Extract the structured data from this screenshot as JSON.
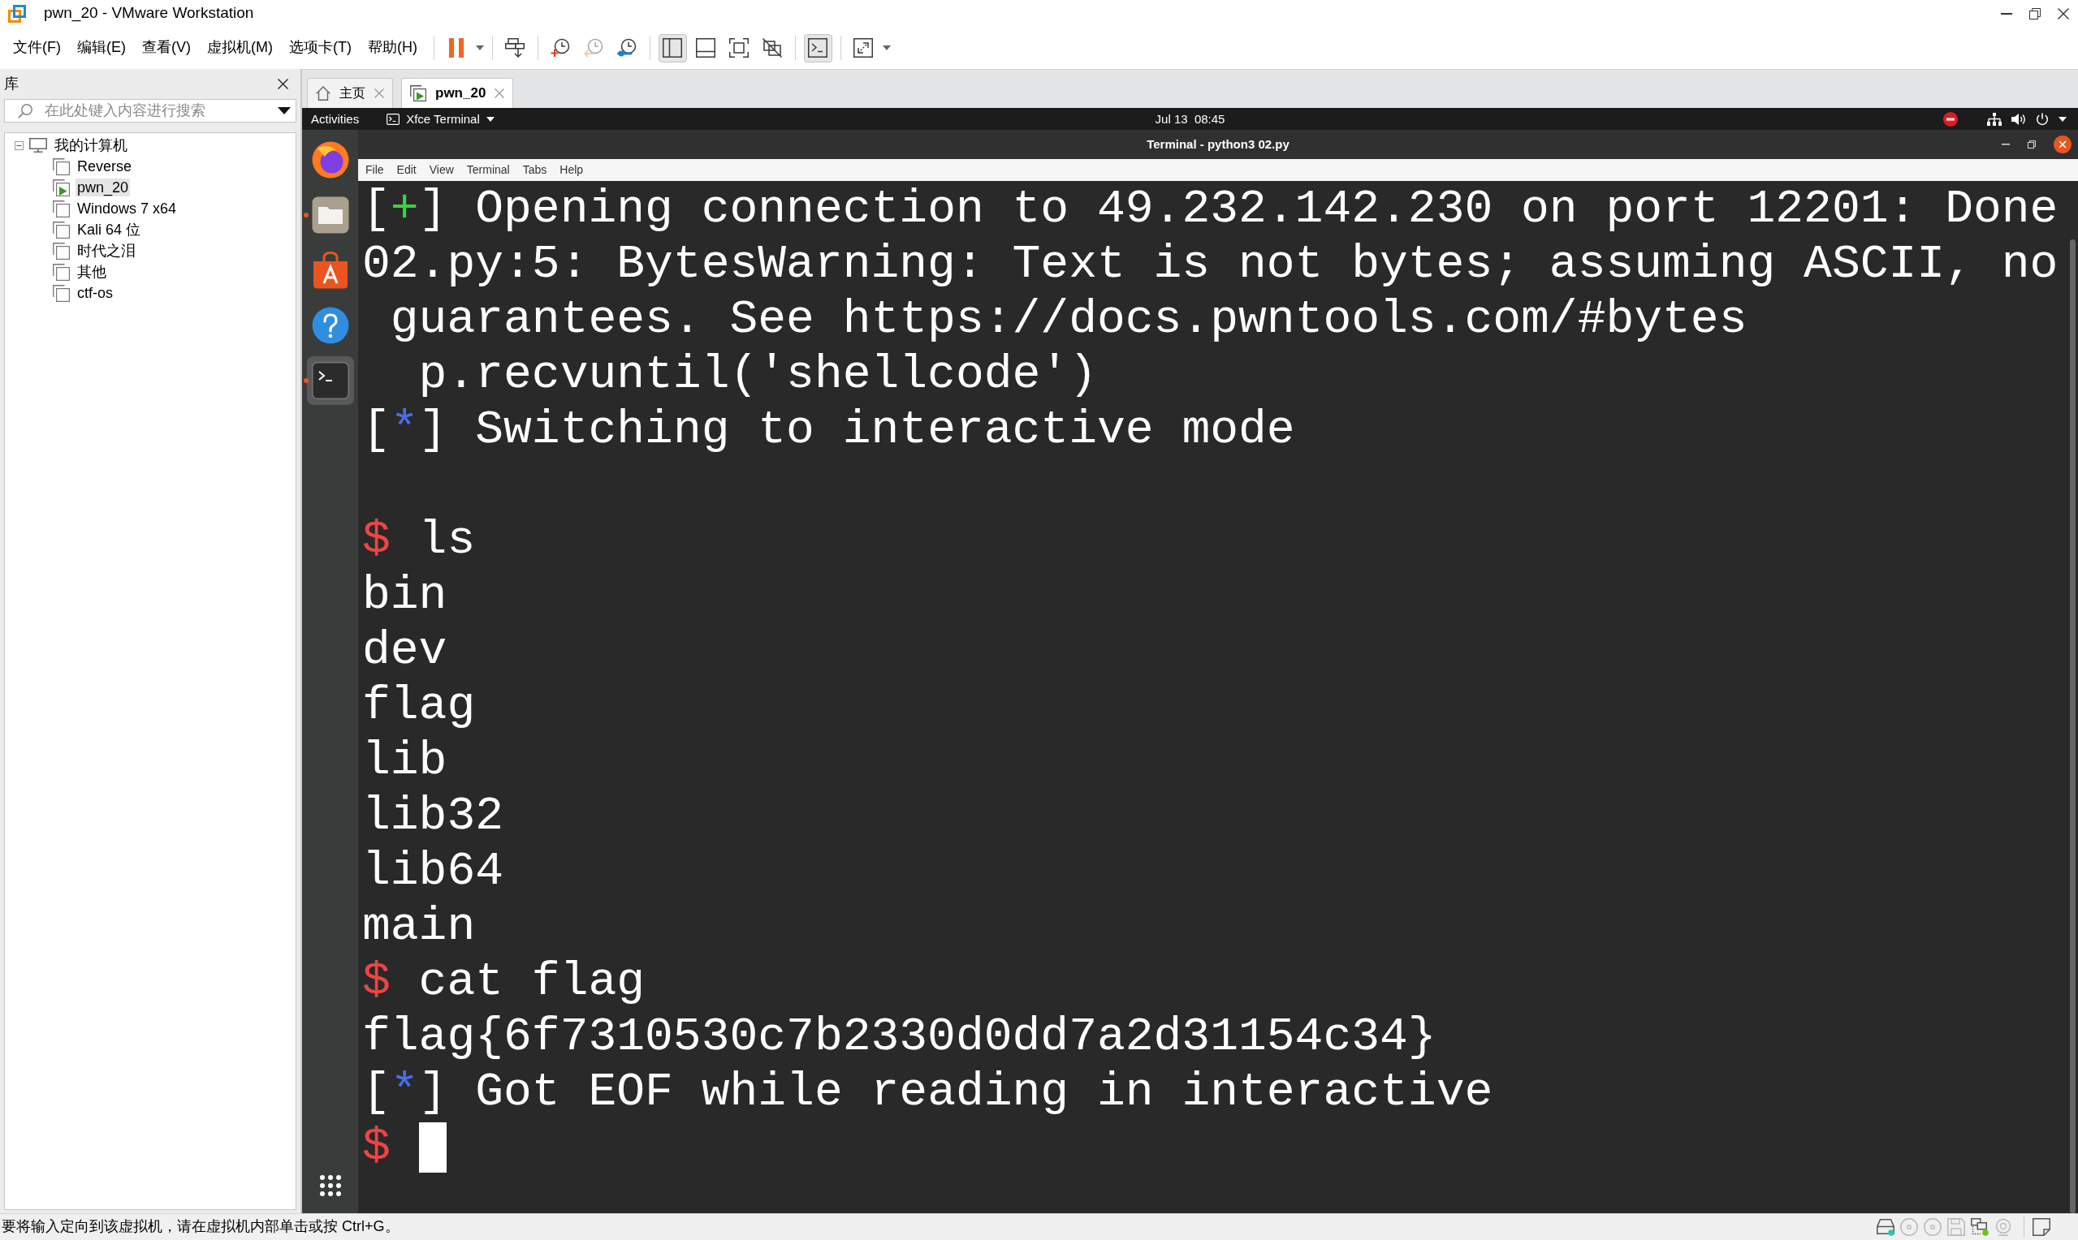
{
  "window": {
    "title": "pwn_20 - VMware Workstation"
  },
  "menu": [
    "文件(F)",
    "编辑(E)",
    "查看(V)",
    "虚拟机(M)",
    "选项卡(T)",
    "帮助(H)"
  ],
  "toolbar": [
    [
      {
        "kind": "pause",
        "menu": true
      }
    ],
    [
      {
        "kind": "send-keys"
      }
    ],
    [
      {
        "kind": "snapshot-take",
        "disabled": false
      },
      {
        "kind": "snapshot-revert",
        "disabled": true
      },
      {
        "kind": "snapshot-manager",
        "disabled": false
      }
    ],
    [
      {
        "kind": "library-view",
        "selected": true
      },
      {
        "kind": "thumbnail-bar",
        "selected": false
      },
      {
        "kind": "full-screen",
        "selected": false
      },
      {
        "kind": "unity",
        "selected": false
      }
    ],
    [
      {
        "kind": "console-view",
        "selected": true
      }
    ],
    [
      {
        "kind": "stretch",
        "menu": true
      }
    ]
  ],
  "library": {
    "title": "库",
    "search": {
      "placeholder": "在此处键入内容进行搜索"
    },
    "tree": [
      {
        "label": "我的计算机",
        "expanded": true,
        "children": [
          {
            "label": "Reverse",
            "selected": false,
            "running": false
          },
          {
            "label": "pwn_20",
            "selected": true,
            "running": true
          },
          {
            "label": "Windows 7 x64",
            "selected": false,
            "running": false
          },
          {
            "label": "Kali 64 位",
            "selected": false,
            "running": false
          },
          {
            "label": "时代之泪",
            "selected": false,
            "running": false
          },
          {
            "label": "其他",
            "selected": false,
            "running": false
          },
          {
            "label": "ctf-os",
            "selected": false,
            "running": false
          }
        ]
      }
    ]
  },
  "tabs": [
    {
      "kind": "home",
      "label": "主页",
      "selected": false
    },
    {
      "kind": "vm",
      "label": "pwn_20",
      "selected": true
    }
  ],
  "guest": {
    "top_bar": {
      "activities": "Activities",
      "app_menu": "Xfce Terminal",
      "clock": "Jul 13  08:45"
    },
    "dock": [
      {
        "kind": "browser",
        "running": false,
        "selected": false
      },
      {
        "kind": "files",
        "running": true,
        "selected": false
      },
      {
        "kind": "software",
        "running": false,
        "selected": false
      },
      {
        "kind": "help",
        "running": false,
        "selected": false
      },
      {
        "kind": "terminal",
        "running": true,
        "selected": true
      }
    ],
    "terminal": {
      "title": "Terminal - python3 02.py",
      "menu": [
        "File",
        "Edit",
        "View",
        "Terminal",
        "Tabs",
        "Help"
      ],
      "lines": [
        {
          "kind": "success",
          "segments": [
            "[",
            "+",
            "] Opening connection to 49.232.142.230 on port 12201: Done"
          ]
        },
        {
          "kind": "output",
          "text": "02.py:5: BytesWarning: Text is not bytes; assuming ASCII, no"
        },
        {
          "kind": "output",
          "text": " guarantees. See https://docs.pwntools.com/#bytes"
        },
        {
          "kind": "output",
          "text": "  p.recvuntil('shellcode')"
        },
        {
          "kind": "info",
          "segments": [
            "[",
            "*",
            "] Switching to interactive mode"
          ]
        },
        {
          "kind": "blank"
        },
        {
          "kind": "prompt",
          "segments": [
            "$",
            " ls"
          ],
          "cursor": false
        },
        {
          "kind": "output",
          "text": "bin"
        },
        {
          "kind": "output",
          "text": "dev"
        },
        {
          "kind": "output",
          "text": "flag"
        },
        {
          "kind": "output",
          "text": "lib"
        },
        {
          "kind": "output",
          "text": "lib32"
        },
        {
          "kind": "output",
          "text": "lib64"
        },
        {
          "kind": "output",
          "text": "main"
        },
        {
          "kind": "prompt",
          "segments": [
            "$",
            " cat flag"
          ],
          "cursor": false
        },
        {
          "kind": "output",
          "text": "flag{6f7310530c7b2330d0dd7a2d31154c34}"
        },
        {
          "kind": "info",
          "segments": [
            "[",
            "*",
            "] Got EOF while reading in interactive"
          ]
        },
        {
          "kind": "prompt",
          "segments": [
            "$"
          ],
          "cursor": true
        }
      ]
    }
  },
  "status_bar": {
    "message": "要将输入定向到该虚拟机，请在虚拟机内部单击或按 Ctrl+G。",
    "devices": [
      {
        "kind": "disk",
        "active": true
      },
      {
        "kind": "disc",
        "active": false
      },
      {
        "kind": "disc",
        "active": false
      },
      {
        "kind": "floppy",
        "active": false
      },
      {
        "kind": "network",
        "active": true
      },
      {
        "kind": "camera",
        "active": false
      }
    ]
  }
}
